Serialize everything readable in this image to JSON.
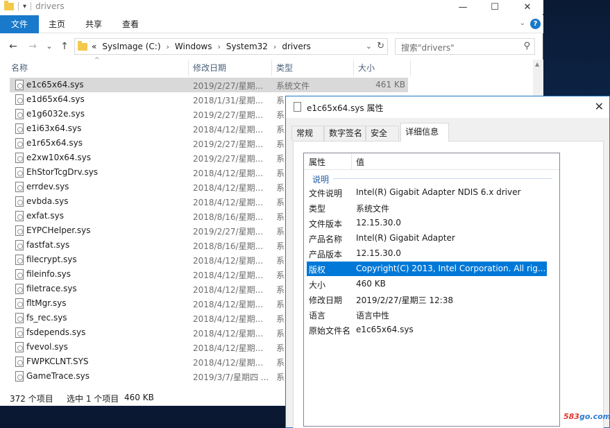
{
  "window": {
    "title": "drivers",
    "minimize": "—",
    "maximize": "☐",
    "close": "✕"
  },
  "ribbon": {
    "tabs": [
      "文件",
      "主页",
      "共享",
      "查看"
    ],
    "expand": "⌄",
    "help": "?"
  },
  "nav": {
    "back": "←",
    "forward": "→",
    "recent": "⌄",
    "up": "↑",
    "breadcrumb_prefix": "«",
    "crumbs": [
      "SysImage (C:)",
      "Windows",
      "System32",
      "drivers"
    ],
    "search_placeholder": "搜索\"drivers\""
  },
  "columns": {
    "name": "名称",
    "date": "修改日期",
    "type": "类型",
    "size": "大小"
  },
  "files": [
    {
      "name": "e1c65x64.sys",
      "date": "2019/2/27/星期...",
      "type": "系统文件",
      "size": "461 KB",
      "selected": true
    },
    {
      "name": "e1d65x64.sys",
      "date": "2018/1/31/星期...",
      "type": "系",
      "size": ""
    },
    {
      "name": "e1g6032e.sys",
      "date": "2019/2/27/星期...",
      "type": "系",
      "size": ""
    },
    {
      "name": "e1i63x64.sys",
      "date": "2018/4/12/星期...",
      "type": "系",
      "size": ""
    },
    {
      "name": "e1r65x64.sys",
      "date": "2019/2/27/星期...",
      "type": "系",
      "size": ""
    },
    {
      "name": "e2xw10x64.sys",
      "date": "2019/2/27/星期...",
      "type": "系",
      "size": ""
    },
    {
      "name": "EhStorTcgDrv.sys",
      "date": "2018/4/12/星期...",
      "type": "系",
      "size": ""
    },
    {
      "name": "errdev.sys",
      "date": "2018/4/12/星期...",
      "type": "系",
      "size": ""
    },
    {
      "name": "evbda.sys",
      "date": "2018/4/12/星期...",
      "type": "系",
      "size": ""
    },
    {
      "name": "exfat.sys",
      "date": "2018/8/16/星期...",
      "type": "系",
      "size": ""
    },
    {
      "name": "EYPCHelper.sys",
      "date": "2019/2/27/星期...",
      "type": "系",
      "size": ""
    },
    {
      "name": "fastfat.sys",
      "date": "2018/8/16/星期...",
      "type": "系",
      "size": ""
    },
    {
      "name": "filecrypt.sys",
      "date": "2018/4/12/星期...",
      "type": "系",
      "size": ""
    },
    {
      "name": "fileinfo.sys",
      "date": "2018/4/12/星期...",
      "type": "系",
      "size": ""
    },
    {
      "name": "filetrace.sys",
      "date": "2018/4/12/星期...",
      "type": "系",
      "size": ""
    },
    {
      "name": "fltMgr.sys",
      "date": "2018/4/12/星期...",
      "type": "系",
      "size": ""
    },
    {
      "name": "fs_rec.sys",
      "date": "2018/4/12/星期...",
      "type": "系",
      "size": ""
    },
    {
      "name": "fsdepends.sys",
      "date": "2018/4/12/星期...",
      "type": "系",
      "size": ""
    },
    {
      "name": "fvevol.sys",
      "date": "2018/4/12/星期...",
      "type": "系",
      "size": ""
    },
    {
      "name": "FWPKCLNT.SYS",
      "date": "2018/4/12/星期...",
      "type": "系",
      "size": ""
    },
    {
      "name": "GameTrace.sys",
      "date": "2019/3/7/星期四 ...",
      "type": "系",
      "size": ""
    }
  ],
  "status": {
    "count": "372 个项目",
    "selection": "选中 1 个项目",
    "size": "460 KB"
  },
  "dialog": {
    "title": "e1c65x64.sys 属性",
    "close": "✕",
    "tabs": [
      "常规",
      "数字签名",
      "安全",
      "详细信息"
    ],
    "active_tab": "详细信息",
    "col_property": "属性",
    "col_value": "值",
    "group": "说明",
    "props": [
      {
        "key": "文件说明",
        "value": "Intel(R) Gigabit Adapter NDIS 6.x driver"
      },
      {
        "key": "类型",
        "value": "系统文件"
      },
      {
        "key": "文件版本",
        "value": "12.15.30.0"
      },
      {
        "key": "产品名称",
        "value": "Intel(R) Gigabit Adapter"
      },
      {
        "key": "产品版本",
        "value": "12.15.30.0"
      },
      {
        "key": "版权",
        "value": "Copyright(C) 2013, Intel Corporation.  All rig...",
        "selected": true
      },
      {
        "key": "大小",
        "value": "460 KB"
      },
      {
        "key": "修改日期",
        "value": "2019/2/27/星期三 12:38"
      },
      {
        "key": "语言",
        "value": "语言中性"
      },
      {
        "key": "原始文件名",
        "value": "e1c65x64.sys"
      }
    ]
  },
  "watermark": {
    "left": "583",
    "right": "go.com"
  },
  "colors": {
    "accent": "#1979ca",
    "selection": "#0078d7",
    "row_selected": "#d9d9d9"
  }
}
